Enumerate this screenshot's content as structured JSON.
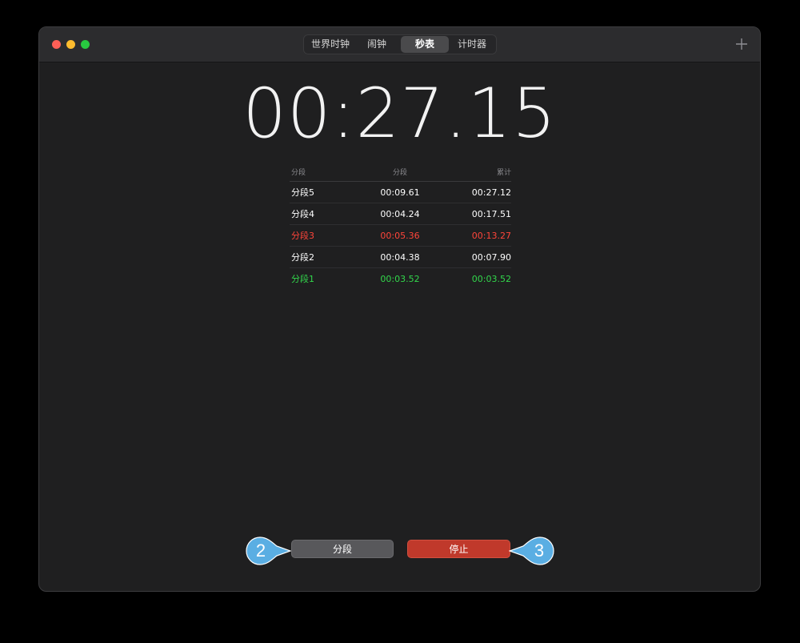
{
  "window": {
    "tabs": [
      {
        "label": "世界时钟",
        "active": false
      },
      {
        "label": "闹钟",
        "active": false
      },
      {
        "label": "秒表",
        "active": true
      },
      {
        "label": "计时器",
        "active": false
      }
    ],
    "add_icon": "plus-icon"
  },
  "stopwatch": {
    "display": "00:27.15"
  },
  "laps": {
    "headers": [
      "分段",
      "分段",
      "累计"
    ],
    "rows": [
      {
        "label": "分段5",
        "split": "00:09.61",
        "total": "00:27.12",
        "status": "normal"
      },
      {
        "label": "分段4",
        "split": "00:04.24",
        "total": "00:17.51",
        "status": "normal"
      },
      {
        "label": "分段3",
        "split": "00:05.36",
        "total": "00:13.27",
        "status": "slowest"
      },
      {
        "label": "分段2",
        "split": "00:04.38",
        "total": "00:07.90",
        "status": "normal"
      },
      {
        "label": "分段1",
        "split": "00:03.52",
        "total": "00:03.52",
        "status": "fastest"
      }
    ]
  },
  "buttons": {
    "lap_label": "分段",
    "stop_label": "停止"
  },
  "callouts": {
    "left_number": "2",
    "right_number": "3"
  },
  "colors": {
    "slowest": "#ff453a",
    "fastest": "#32d74b",
    "normal": "#ffffff",
    "stop_button": "#c0392b",
    "callout": "#5aaee3"
  }
}
